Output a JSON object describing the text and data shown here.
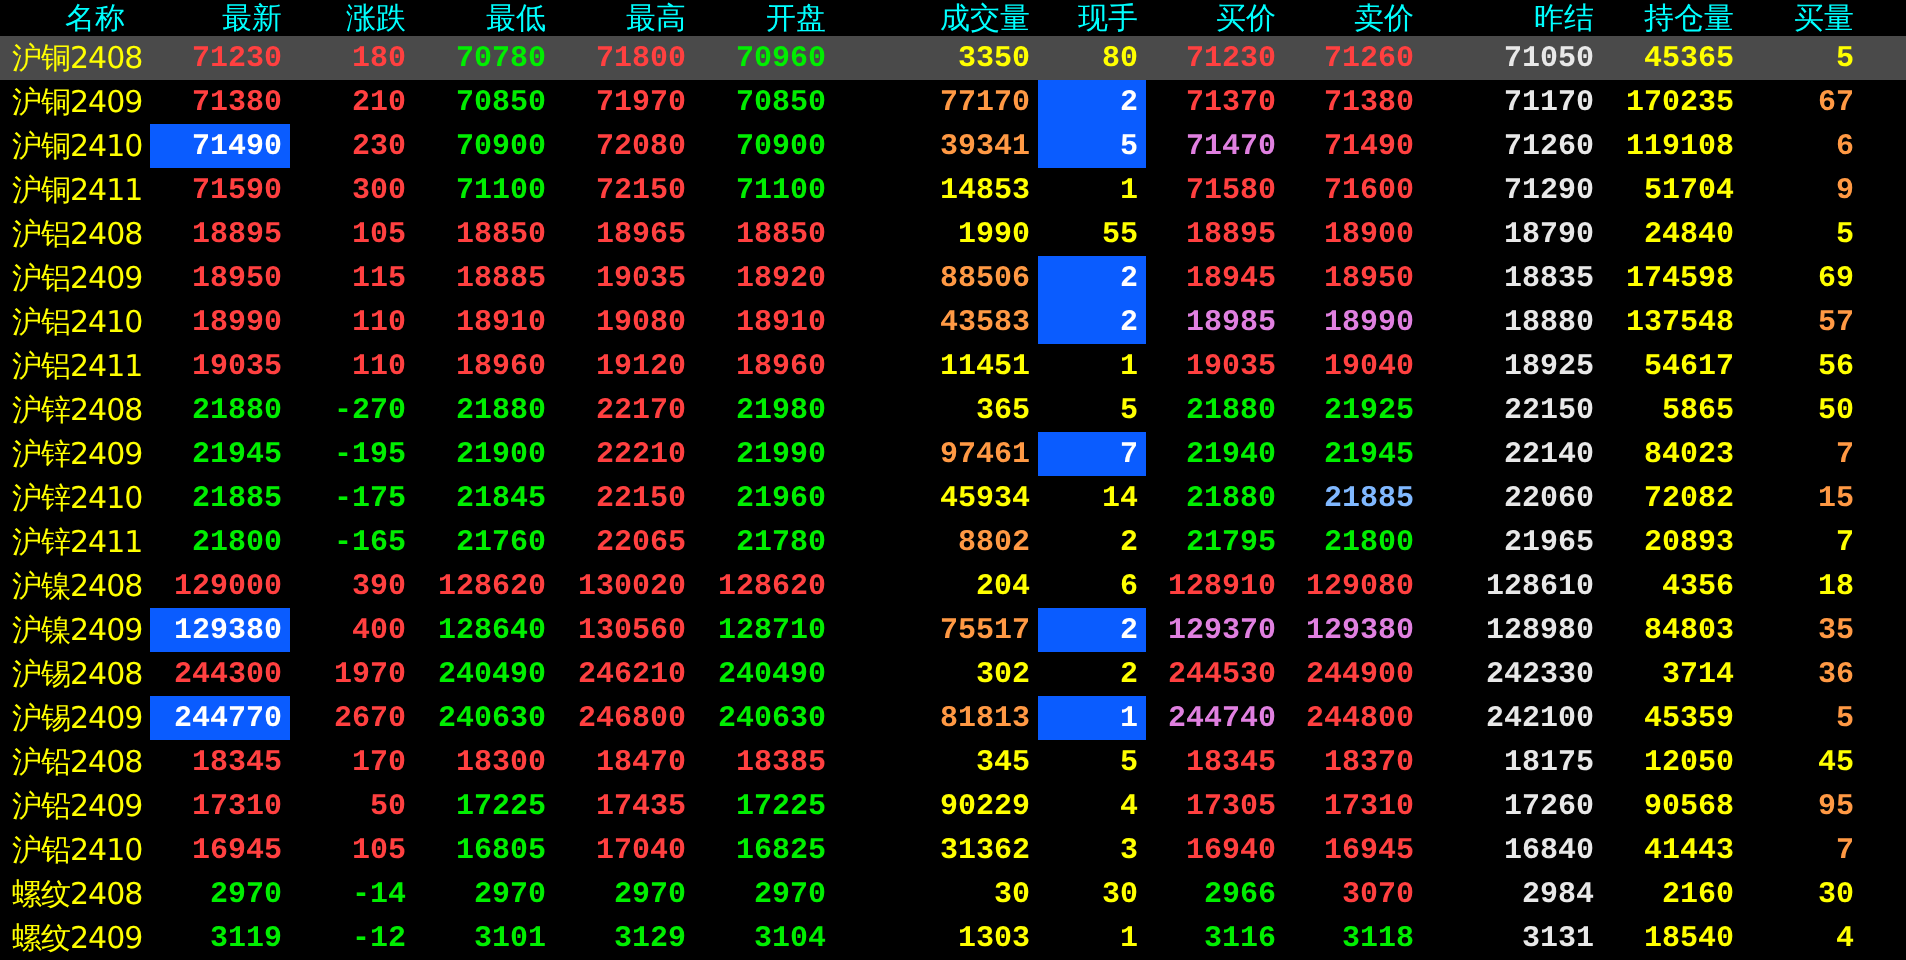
{
  "columns": [
    "名称",
    "最新",
    "涨跌",
    "最低",
    "最高",
    "开盘",
    "成交量",
    "现手",
    "买价",
    "卖价",
    "昨结",
    "持仓量",
    "买量"
  ],
  "rows": [
    {
      "name": "沪铜2408",
      "selected": true,
      "latest_highlighted": false,
      "hand_highlighted": false,
      "cells": [
        {
          "text": "71230",
          "color": "#ff4040"
        },
        {
          "text": "180",
          "color": "#ff4040"
        },
        {
          "text": "70780",
          "color": "#00ee00"
        },
        {
          "text": "71800",
          "color": "#ff4040"
        },
        {
          "text": "70960",
          "color": "#00ee00"
        },
        {
          "text": "3350",
          "color": "#ffff00"
        },
        {
          "text": "80",
          "color": "#ffff00"
        },
        {
          "text": "71230",
          "color": "#ff4040"
        },
        {
          "text": "71260",
          "color": "#ff4040"
        },
        {
          "text": "71050",
          "color": "#e8e8e8"
        },
        {
          "text": "45365",
          "color": "#ffff00"
        },
        {
          "text": "5",
          "color": "#ffff00"
        }
      ]
    },
    {
      "name": "沪铜2409",
      "selected": false,
      "latest_highlighted": false,
      "hand_highlighted": true,
      "cells": [
        {
          "text": "71380",
          "color": "#ff4040"
        },
        {
          "text": "210",
          "color": "#ff4040"
        },
        {
          "text": "70850",
          "color": "#00ee00"
        },
        {
          "text": "71970",
          "color": "#ff4040"
        },
        {
          "text": "70850",
          "color": "#00ee00"
        },
        {
          "text": "77170",
          "color": "#ff9944"
        },
        {
          "text": "2",
          "color": "#ffffff"
        },
        {
          "text": "71370",
          "color": "#ff4040"
        },
        {
          "text": "71380",
          "color": "#ff4040"
        },
        {
          "text": "71170",
          "color": "#e8e8e8"
        },
        {
          "text": "170235",
          "color": "#ffff00"
        },
        {
          "text": "67",
          "color": "#ff9944"
        }
      ]
    },
    {
      "name": "沪铜2410",
      "selected": false,
      "latest_highlighted": true,
      "hand_highlighted": true,
      "cells": [
        {
          "text": "71490",
          "color": "#ffffff"
        },
        {
          "text": "230",
          "color": "#ff4040"
        },
        {
          "text": "70900",
          "color": "#00ee00"
        },
        {
          "text": "72080",
          "color": "#ff4040"
        },
        {
          "text": "70900",
          "color": "#00ee00"
        },
        {
          "text": "39341",
          "color": "#ff9944"
        },
        {
          "text": "5",
          "color": "#ffffff"
        },
        {
          "text": "71470",
          "color": "#e080e0"
        },
        {
          "text": "71490",
          "color": "#ff4040"
        },
        {
          "text": "71260",
          "color": "#e8e8e8"
        },
        {
          "text": "119108",
          "color": "#ffff00"
        },
        {
          "text": "6",
          "color": "#ff9944"
        }
      ]
    },
    {
      "name": "沪铜2411",
      "selected": false,
      "latest_highlighted": false,
      "hand_highlighted": false,
      "cells": [
        {
          "text": "71590",
          "color": "#ff4040"
        },
        {
          "text": "300",
          "color": "#ff4040"
        },
        {
          "text": "71100",
          "color": "#00ee00"
        },
        {
          "text": "72150",
          "color": "#ff4040"
        },
        {
          "text": "71100",
          "color": "#00ee00"
        },
        {
          "text": "14853",
          "color": "#ffff00"
        },
        {
          "text": "1",
          "color": "#ffff00"
        },
        {
          "text": "71580",
          "color": "#ff4040"
        },
        {
          "text": "71600",
          "color": "#ff4040"
        },
        {
          "text": "71290",
          "color": "#e8e8e8"
        },
        {
          "text": "51704",
          "color": "#ffff00"
        },
        {
          "text": "9",
          "color": "#ff9944"
        }
      ]
    },
    {
      "name": "沪铝2408",
      "selected": false,
      "latest_highlighted": false,
      "hand_highlighted": false,
      "cells": [
        {
          "text": "18895",
          "color": "#ff4040"
        },
        {
          "text": "105",
          "color": "#ff4040"
        },
        {
          "text": "18850",
          "color": "#ff4040"
        },
        {
          "text": "18965",
          "color": "#ff4040"
        },
        {
          "text": "18850",
          "color": "#ff4040"
        },
        {
          "text": "1990",
          "color": "#ffff00"
        },
        {
          "text": "55",
          "color": "#ffff00"
        },
        {
          "text": "18895",
          "color": "#ff4040"
        },
        {
          "text": "18900",
          "color": "#ff4040"
        },
        {
          "text": "18790",
          "color": "#e8e8e8"
        },
        {
          "text": "24840",
          "color": "#ffff00"
        },
        {
          "text": "5",
          "color": "#ffff00"
        }
      ]
    },
    {
      "name": "沪铝2409",
      "selected": false,
      "latest_highlighted": false,
      "hand_highlighted": true,
      "cells": [
        {
          "text": "18950",
          "color": "#ff4040"
        },
        {
          "text": "115",
          "color": "#ff4040"
        },
        {
          "text": "18885",
          "color": "#ff4040"
        },
        {
          "text": "19035",
          "color": "#ff4040"
        },
        {
          "text": "18920",
          "color": "#ff4040"
        },
        {
          "text": "88506",
          "color": "#ff9944"
        },
        {
          "text": "2",
          "color": "#ffffff"
        },
        {
          "text": "18945",
          "color": "#ff4040"
        },
        {
          "text": "18950",
          "color": "#ff4040"
        },
        {
          "text": "18835",
          "color": "#e8e8e8"
        },
        {
          "text": "174598",
          "color": "#ffff00"
        },
        {
          "text": "69",
          "color": "#ffff00"
        }
      ]
    },
    {
      "name": "沪铝2410",
      "selected": false,
      "latest_highlighted": false,
      "hand_highlighted": true,
      "cells": [
        {
          "text": "18990",
          "color": "#ff4040"
        },
        {
          "text": "110",
          "color": "#ff4040"
        },
        {
          "text": "18910",
          "color": "#ff4040"
        },
        {
          "text": "19080",
          "color": "#ff4040"
        },
        {
          "text": "18910",
          "color": "#ff4040"
        },
        {
          "text": "43583",
          "color": "#ff9944"
        },
        {
          "text": "2",
          "color": "#ffffff"
        },
        {
          "text": "18985",
          "color": "#e080e0"
        },
        {
          "text": "18990",
          "color": "#e080e0"
        },
        {
          "text": "18880",
          "color": "#e8e8e8"
        },
        {
          "text": "137548",
          "color": "#ffff00"
        },
        {
          "text": "57",
          "color": "#ff9944"
        }
      ]
    },
    {
      "name": "沪铝2411",
      "selected": false,
      "latest_highlighted": false,
      "hand_highlighted": false,
      "cells": [
        {
          "text": "19035",
          "color": "#ff4040"
        },
        {
          "text": "110",
          "color": "#ff4040"
        },
        {
          "text": "18960",
          "color": "#ff4040"
        },
        {
          "text": "19120",
          "color": "#ff4040"
        },
        {
          "text": "18960",
          "color": "#ff4040"
        },
        {
          "text": "11451",
          "color": "#ffff00"
        },
        {
          "text": "1",
          "color": "#ffff00"
        },
        {
          "text": "19035",
          "color": "#ff4040"
        },
        {
          "text": "19040",
          "color": "#ff4040"
        },
        {
          "text": "18925",
          "color": "#e8e8e8"
        },
        {
          "text": "54617",
          "color": "#ffff00"
        },
        {
          "text": "56",
          "color": "#ffff00"
        }
      ]
    },
    {
      "name": "沪锌2408",
      "selected": false,
      "latest_highlighted": false,
      "hand_highlighted": false,
      "cells": [
        {
          "text": "21880",
          "color": "#00ee00"
        },
        {
          "text": "-270",
          "color": "#00ee00"
        },
        {
          "text": "21880",
          "color": "#00ee00"
        },
        {
          "text": "22170",
          "color": "#ff4040"
        },
        {
          "text": "21980",
          "color": "#00ee00"
        },
        {
          "text": "365",
          "color": "#ffff00"
        },
        {
          "text": "5",
          "color": "#ffff00"
        },
        {
          "text": "21880",
          "color": "#00ee00"
        },
        {
          "text": "21925",
          "color": "#00ee00"
        },
        {
          "text": "22150",
          "color": "#e8e8e8"
        },
        {
          "text": "5865",
          "color": "#ffff00"
        },
        {
          "text": "50",
          "color": "#ffff00"
        }
      ]
    },
    {
      "name": "沪锌2409",
      "selected": false,
      "latest_highlighted": false,
      "hand_highlighted": true,
      "cells": [
        {
          "text": "21945",
          "color": "#00ee00"
        },
        {
          "text": "-195",
          "color": "#00ee00"
        },
        {
          "text": "21900",
          "color": "#00ee00"
        },
        {
          "text": "22210",
          "color": "#ff4040"
        },
        {
          "text": "21990",
          "color": "#00ee00"
        },
        {
          "text": "97461",
          "color": "#ff9944"
        },
        {
          "text": "7",
          "color": "#ffffff"
        },
        {
          "text": "21940",
          "color": "#00ee00"
        },
        {
          "text": "21945",
          "color": "#00ee00"
        },
        {
          "text": "22140",
          "color": "#e8e8e8"
        },
        {
          "text": "84023",
          "color": "#ffff00"
        },
        {
          "text": "7",
          "color": "#ff9944"
        }
      ]
    },
    {
      "name": "沪锌2410",
      "selected": false,
      "latest_highlighted": false,
      "hand_highlighted": false,
      "cells": [
        {
          "text": "21885",
          "color": "#00ee00"
        },
        {
          "text": "-175",
          "color": "#00ee00"
        },
        {
          "text": "21845",
          "color": "#00ee00"
        },
        {
          "text": "22150",
          "color": "#ff4040"
        },
        {
          "text": "21960",
          "color": "#00ee00"
        },
        {
          "text": "45934",
          "color": "#ffff00"
        },
        {
          "text": "14",
          "color": "#ffff00"
        },
        {
          "text": "21880",
          "color": "#00ee00"
        },
        {
          "text": "21885",
          "color": "#80b8ff"
        },
        {
          "text": "22060",
          "color": "#e8e8e8"
        },
        {
          "text": "72082",
          "color": "#ffff00"
        },
        {
          "text": "15",
          "color": "#ff9944"
        }
      ]
    },
    {
      "name": "沪锌2411",
      "selected": false,
      "latest_highlighted": false,
      "hand_highlighted": false,
      "cells": [
        {
          "text": "21800",
          "color": "#00ee00"
        },
        {
          "text": "-165",
          "color": "#00ee00"
        },
        {
          "text": "21760",
          "color": "#00ee00"
        },
        {
          "text": "22065",
          "color": "#ff4040"
        },
        {
          "text": "21780",
          "color": "#00ee00"
        },
        {
          "text": "8802",
          "color": "#ff9944"
        },
        {
          "text": "2",
          "color": "#ffff00"
        },
        {
          "text": "21795",
          "color": "#00ee00"
        },
        {
          "text": "21800",
          "color": "#00ee00"
        },
        {
          "text": "21965",
          "color": "#e8e8e8"
        },
        {
          "text": "20893",
          "color": "#ffff00"
        },
        {
          "text": "7",
          "color": "#ffff00"
        }
      ]
    },
    {
      "name": "沪镍2408",
      "selected": false,
      "latest_highlighted": false,
      "hand_highlighted": false,
      "cells": [
        {
          "text": "129000",
          "color": "#ff4040"
        },
        {
          "text": "390",
          "color": "#ff4040"
        },
        {
          "text": "128620",
          "color": "#ff4040"
        },
        {
          "text": "130020",
          "color": "#ff4040"
        },
        {
          "text": "128620",
          "color": "#ff4040"
        },
        {
          "text": "204",
          "color": "#ffff00"
        },
        {
          "text": "6",
          "color": "#ffff00"
        },
        {
          "text": "128910",
          "color": "#ff4040"
        },
        {
          "text": "129080",
          "color": "#ff4040"
        },
        {
          "text": "128610",
          "color": "#e8e8e8"
        },
        {
          "text": "4356",
          "color": "#ffff00"
        },
        {
          "text": "18",
          "color": "#ffff00"
        }
      ]
    },
    {
      "name": "沪镍2409",
      "selected": false,
      "latest_highlighted": true,
      "hand_highlighted": true,
      "cells": [
        {
          "text": "129380",
          "color": "#ffffff"
        },
        {
          "text": "400",
          "color": "#ff4040"
        },
        {
          "text": "128640",
          "color": "#00ee00"
        },
        {
          "text": "130560",
          "color": "#ff4040"
        },
        {
          "text": "128710",
          "color": "#00ee00"
        },
        {
          "text": "75517",
          "color": "#ff9944"
        },
        {
          "text": "2",
          "color": "#ffffff"
        },
        {
          "text": "129370",
          "color": "#e080e0"
        },
        {
          "text": "129380",
          "color": "#e080e0"
        },
        {
          "text": "128980",
          "color": "#e8e8e8"
        },
        {
          "text": "84803",
          "color": "#ffff00"
        },
        {
          "text": "35",
          "color": "#ff9944"
        }
      ]
    },
    {
      "name": "沪锡2408",
      "selected": false,
      "latest_highlighted": false,
      "hand_highlighted": false,
      "cells": [
        {
          "text": "244300",
          "color": "#ff4040"
        },
        {
          "text": "1970",
          "color": "#ff4040"
        },
        {
          "text": "240490",
          "color": "#00ee00"
        },
        {
          "text": "246210",
          "color": "#ff4040"
        },
        {
          "text": "240490",
          "color": "#00ee00"
        },
        {
          "text": "302",
          "color": "#ffff00"
        },
        {
          "text": "2",
          "color": "#ffff00"
        },
        {
          "text": "244530",
          "color": "#ff4040"
        },
        {
          "text": "244900",
          "color": "#ff4040"
        },
        {
          "text": "242330",
          "color": "#e8e8e8"
        },
        {
          "text": "3714",
          "color": "#ffff00"
        },
        {
          "text": "36",
          "color": "#ff9944"
        }
      ]
    },
    {
      "name": "沪锡2409",
      "selected": false,
      "latest_highlighted": true,
      "hand_highlighted": true,
      "cells": [
        {
          "text": "244770",
          "color": "#ffffff"
        },
        {
          "text": "2670",
          "color": "#ff4040"
        },
        {
          "text": "240630",
          "color": "#00ee00"
        },
        {
          "text": "246800",
          "color": "#ff4040"
        },
        {
          "text": "240630",
          "color": "#00ee00"
        },
        {
          "text": "81813",
          "color": "#ff9944"
        },
        {
          "text": "1",
          "color": "#ffffff"
        },
        {
          "text": "244740",
          "color": "#e080e0"
        },
        {
          "text": "244800",
          "color": "#ff4040"
        },
        {
          "text": "242100",
          "color": "#e8e8e8"
        },
        {
          "text": "45359",
          "color": "#ffff00"
        },
        {
          "text": "5",
          "color": "#ff9944"
        }
      ]
    },
    {
      "name": "沪铅2408",
      "selected": false,
      "latest_highlighted": false,
      "hand_highlighted": false,
      "cells": [
        {
          "text": "18345",
          "color": "#ff4040"
        },
        {
          "text": "170",
          "color": "#ff4040"
        },
        {
          "text": "18300",
          "color": "#ff4040"
        },
        {
          "text": "18470",
          "color": "#ff4040"
        },
        {
          "text": "18385",
          "color": "#ff4040"
        },
        {
          "text": "345",
          "color": "#ffff00"
        },
        {
          "text": "5",
          "color": "#ffff00"
        },
        {
          "text": "18345",
          "color": "#ff4040"
        },
        {
          "text": "18370",
          "color": "#ff4040"
        },
        {
          "text": "18175",
          "color": "#e8e8e8"
        },
        {
          "text": "12050",
          "color": "#ffff00"
        },
        {
          "text": "45",
          "color": "#ffff00"
        }
      ]
    },
    {
      "name": "沪铅2409",
      "selected": false,
      "latest_highlighted": false,
      "hand_highlighted": false,
      "cells": [
        {
          "text": "17310",
          "color": "#ff4040"
        },
        {
          "text": "50",
          "color": "#ff4040"
        },
        {
          "text": "17225",
          "color": "#00ee00"
        },
        {
          "text": "17435",
          "color": "#ff4040"
        },
        {
          "text": "17225",
          "color": "#00ee00"
        },
        {
          "text": "90229",
          "color": "#ffff00"
        },
        {
          "text": "4",
          "color": "#ffff00"
        },
        {
          "text": "17305",
          "color": "#ff4040"
        },
        {
          "text": "17310",
          "color": "#ff4040"
        },
        {
          "text": "17260",
          "color": "#e8e8e8"
        },
        {
          "text": "90568",
          "color": "#ffff00"
        },
        {
          "text": "95",
          "color": "#ff9944"
        }
      ]
    },
    {
      "name": "沪铅2410",
      "selected": false,
      "latest_highlighted": false,
      "hand_highlighted": false,
      "cells": [
        {
          "text": "16945",
          "color": "#ff4040"
        },
        {
          "text": "105",
          "color": "#ff4040"
        },
        {
          "text": "16805",
          "color": "#00ee00"
        },
        {
          "text": "17040",
          "color": "#ff4040"
        },
        {
          "text": "16825",
          "color": "#00ee00"
        },
        {
          "text": "31362",
          "color": "#ffff00"
        },
        {
          "text": "3",
          "color": "#ffff00"
        },
        {
          "text": "16940",
          "color": "#ff4040"
        },
        {
          "text": "16945",
          "color": "#ff4040"
        },
        {
          "text": "16840",
          "color": "#e8e8e8"
        },
        {
          "text": "41443",
          "color": "#ffff00"
        },
        {
          "text": "7",
          "color": "#ff9944"
        }
      ]
    },
    {
      "name": "螺纹2408",
      "selected": false,
      "latest_highlighted": false,
      "hand_highlighted": false,
      "cells": [
        {
          "text": "2970",
          "color": "#00ee00"
        },
        {
          "text": "-14",
          "color": "#00ee00"
        },
        {
          "text": "2970",
          "color": "#00ee00"
        },
        {
          "text": "2970",
          "color": "#00ee00"
        },
        {
          "text": "2970",
          "color": "#00ee00"
        },
        {
          "text": "30",
          "color": "#ffff00"
        },
        {
          "text": "30",
          "color": "#ffff00"
        },
        {
          "text": "2966",
          "color": "#00ee00"
        },
        {
          "text": "3070",
          "color": "#ff4040"
        },
        {
          "text": "2984",
          "color": "#e8e8e8"
        },
        {
          "text": "2160",
          "color": "#ffff00"
        },
        {
          "text": "30",
          "color": "#ffff00"
        }
      ]
    },
    {
      "name": "螺纹2409",
      "selected": false,
      "latest_highlighted": false,
      "hand_highlighted": false,
      "cells": [
        {
          "text": "3119",
          "color": "#00ee00"
        },
        {
          "text": "-12",
          "color": "#00ee00"
        },
        {
          "text": "3101",
          "color": "#00ee00"
        },
        {
          "text": "3129",
          "color": "#00ee00"
        },
        {
          "text": "3104",
          "color": "#00ee00"
        },
        {
          "text": "1303",
          "color": "#ffff00"
        },
        {
          "text": "1",
          "color": "#ffff00"
        },
        {
          "text": "3116",
          "color": "#00ee00"
        },
        {
          "text": "3118",
          "color": "#00ee00"
        },
        {
          "text": "3131",
          "color": "#e8e8e8"
        },
        {
          "text": "18540",
          "color": "#ffff00"
        },
        {
          "text": "4",
          "color": "#ffff00"
        }
      ]
    }
  ]
}
